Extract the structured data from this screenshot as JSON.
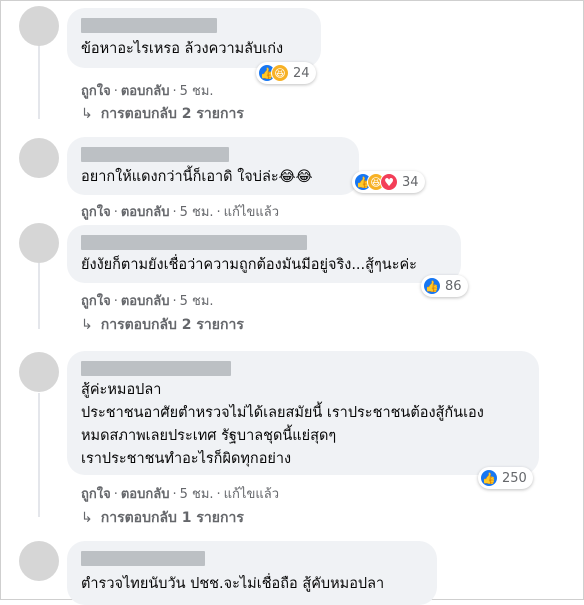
{
  "actions": {
    "like": "ถูกใจ",
    "reply": "ตอบกลับ",
    "dot": "·"
  },
  "comments": [
    {
      "lines": [
        "ข้อหาอะไรเหรอ ล้วงความลับเก่ง"
      ],
      "time": "5 ชม.",
      "edited": "",
      "reactions": {
        "icons": [
          "like-icon",
          "haha-icon"
        ],
        "count": "24"
      },
      "replies": "การตอบกลับ 2 รายการ"
    },
    {
      "lines": [
        "อยากให้แดงกว่านี้ก็เอาดิ ใจบ่ล่ะ😂😂"
      ],
      "time": "5 ชม.",
      "edited": "แก้ไขแล้ว",
      "reactions": {
        "icons": [
          "like-icon",
          "haha-icon",
          "love-icon"
        ],
        "count": "34"
      },
      "replies": ""
    },
    {
      "lines": [
        "ยังงัยก็ตามยังเชื่อว่าความถูกต้องมันมีอยู่จริง...สู้ๆนะค่ะ"
      ],
      "time": "5 ชม.",
      "edited": "",
      "reactions": {
        "icons": [
          "like-icon"
        ],
        "count": "86"
      },
      "replies": "การตอบกลับ 2 รายการ"
    },
    {
      "lines": [
        "สู้ค่ะหมอปลา",
        "ประชาชนอาศัยตำหรวจไม่ได้เลยสมัยนี้ เราประชาชนต้องสู้กันเอง",
        "หมดสภาพเลยประเทศ รัฐบาลชุดนี้แย่สุดๆ",
        "เราประชาชนทำอะไรก็ผิดทุกอย่าง"
      ],
      "time": "5 ชม.",
      "edited": "แก้ไขแล้ว",
      "reactions": {
        "icons": [
          "like-icon"
        ],
        "count": "250"
      },
      "replies": "การตอบกลับ 1 รายการ"
    },
    {
      "lines": [
        "ตำรวจไทยนับวัน ปชช.จะไม่เชื่อถือ สู้คับหมอปลา"
      ],
      "time": "",
      "edited": "",
      "reactions": {
        "icons": [],
        "count": ""
      },
      "replies": ""
    }
  ]
}
